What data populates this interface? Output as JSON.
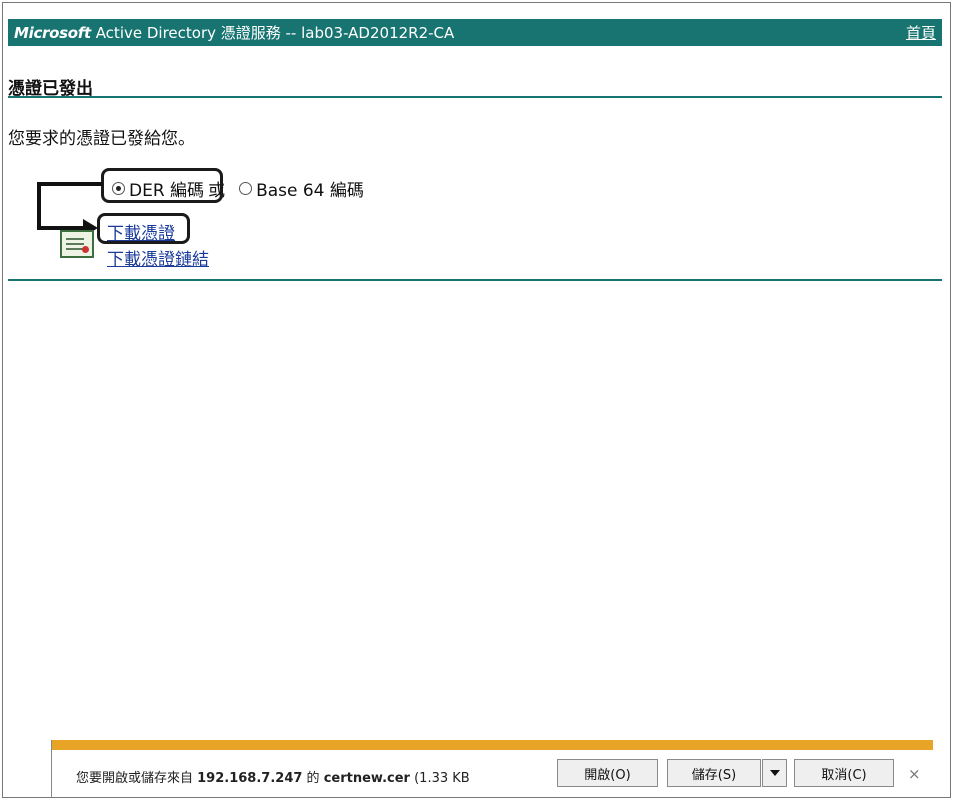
{
  "header": {
    "brand": "Microsoft",
    "title": "Active Directory 憑證服務  --  lab03-AD2012R2-CA",
    "home_link": "首頁"
  },
  "page": {
    "title": "憑證已發出",
    "message": "您要求的憑證已發給您。"
  },
  "encoding": {
    "option_der": "DER 編碼",
    "separator": "或",
    "option_base64": "Base 64 編碼",
    "selected": "DER 編碼"
  },
  "links": {
    "download_cert": "下載憑證",
    "download_chain": "下載憑證鏈結"
  },
  "notification": {
    "prefix": "您要開啟或儲存來自 ",
    "host": "192.168.7.247",
    "middle": " 的 ",
    "filename": "certnew.cer",
    "suffix": " (1.33 KB",
    "open_button": "開啟(O)",
    "save_button": "儲存(S)",
    "cancel_button": "取消(C)",
    "close_glyph": "×"
  },
  "icons": {
    "certificate": "certificate-icon",
    "dropdown": "chevron-down-icon",
    "close": "close-icon"
  },
  "colors": {
    "header_bg": "#187470",
    "notification_bar": "#e8a427",
    "link": "#1a3a9a"
  }
}
